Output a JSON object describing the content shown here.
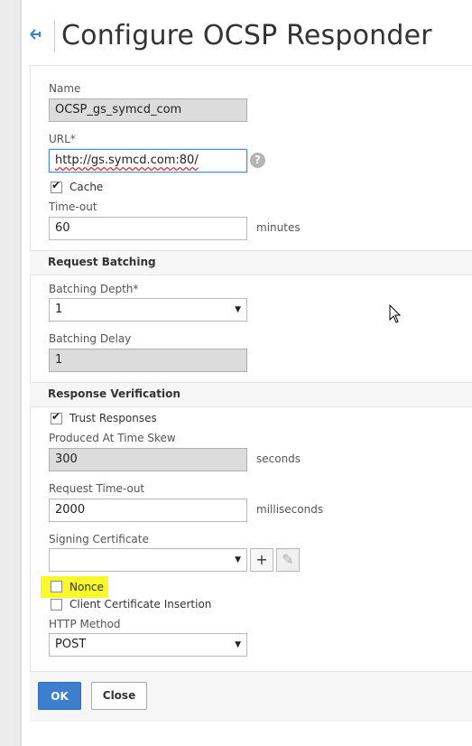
{
  "header": {
    "title": "Configure OCSP Responder",
    "back_icon": "back-arrow-icon"
  },
  "form": {
    "name_label": "Name",
    "name_value": "OCSP_gs_symcd_com",
    "url_label": "URL*",
    "url_value": "http://gs.symcd.com:80/",
    "help_glyph": "?",
    "cache_label": "Cache",
    "cache_checked": true,
    "timeout_label": "Time-out",
    "timeout_value": "60",
    "timeout_unit": "minutes"
  },
  "request_batching": {
    "heading": "Request Batching",
    "depth_label": "Batching Depth*",
    "depth_value": "1",
    "delay_label": "Batching Delay",
    "delay_value": "1"
  },
  "response_verification": {
    "heading": "Response Verification",
    "trust_label": "Trust Responses",
    "trust_checked": true,
    "skew_label": "Produced At Time Skew",
    "skew_value": "300",
    "skew_unit": "seconds",
    "req_timeout_label": "Request Time-out",
    "req_timeout_value": "2000",
    "req_timeout_unit": "milliseconds",
    "signing_label": "Signing Certificate",
    "signing_value": "",
    "add_glyph": "+",
    "edit_glyph": "✎",
    "nonce_label": "Nonce",
    "nonce_checked": false,
    "client_cert_label": "Client Certificate Insertion",
    "client_cert_checked": false,
    "http_method_label": "HTTP Method",
    "http_method_value": "POST"
  },
  "footer": {
    "ok_label": "OK",
    "close_label": "Close"
  },
  "colors": {
    "accent": "#3d7fce",
    "highlight": "#f8f82b"
  }
}
